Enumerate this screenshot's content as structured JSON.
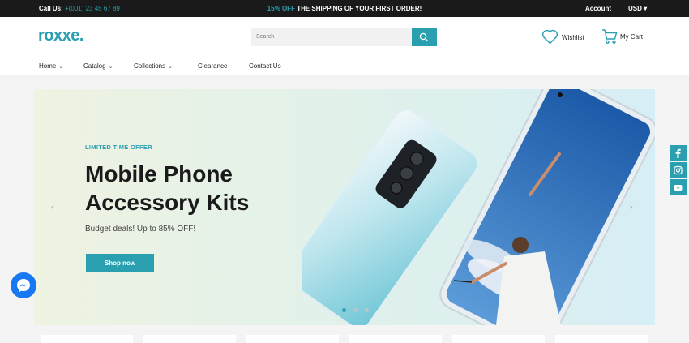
{
  "topbar": {
    "call_label": "Call Us:",
    "phone": "+(001) 23 45 67 89",
    "promo_highlight": "15% OFF",
    "promo_text": "THE SHIPPING OF YOUR FIRST ORDER!",
    "account": "Account",
    "currency": "USD"
  },
  "header": {
    "logo": "roxxe.",
    "search_placeholder": "Search",
    "wishlist": "Wishlist",
    "cart": "My Cart"
  },
  "nav": {
    "home": "Home",
    "catalog": "Catalog",
    "collections": "Collections",
    "clearance": "Clearance",
    "contact": "Contact Us"
  },
  "hero": {
    "eyebrow": "LIMITED TIME OFFER",
    "title_line1": "Mobile Phone",
    "title_line2": "Accessory Kits",
    "subtitle": "Budget deals! Up to 85% OFF!",
    "cta": "Shop now",
    "slide_index": 1,
    "slide_count": 3
  },
  "social": [
    "facebook-icon",
    "instagram-icon",
    "youtube-icon"
  ],
  "colors": {
    "accent": "#2a9fb0",
    "topbar_bg": "#1a1a1a",
    "messenger": "#1877f2"
  }
}
